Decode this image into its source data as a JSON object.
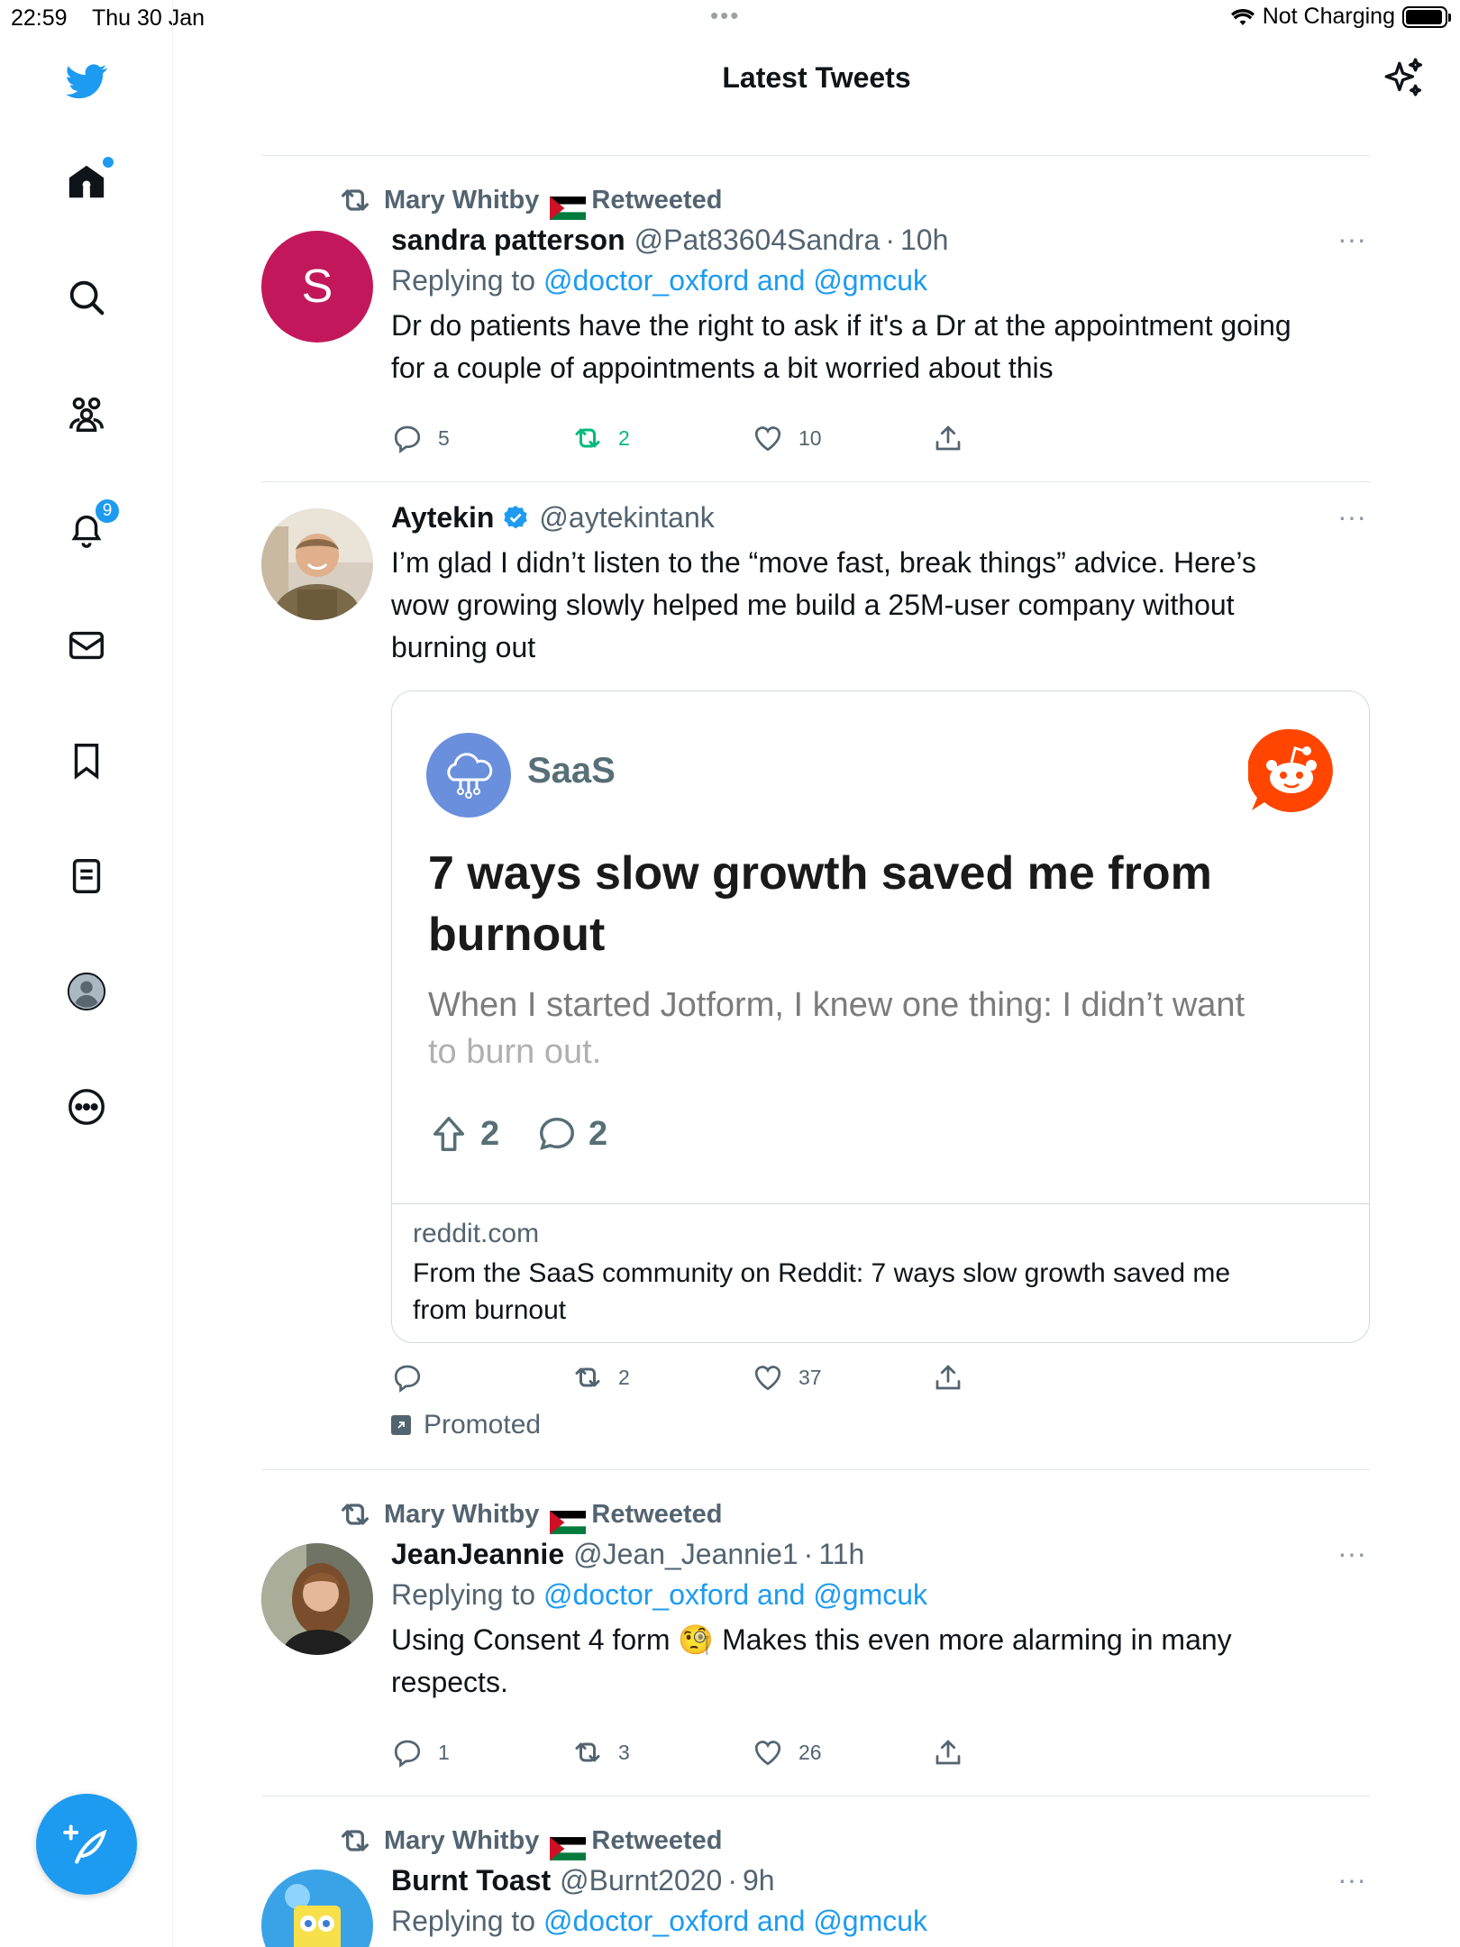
{
  "status_bar": {
    "time": "22:59",
    "date": "Thu 30 Jan",
    "dots": "•••",
    "charging": "Not Charging",
    "battery_level_fraction": 0.95
  },
  "header": {
    "title": "Latest Tweets",
    "sparkle_icon": "sparkle-icon"
  },
  "sidebar": {
    "items": [
      {
        "icon": "twitter-logo-icon"
      },
      {
        "icon": "home-icon"
      },
      {
        "icon": "search-icon"
      },
      {
        "icon": "communities-icon"
      },
      {
        "icon": "notifications-icon",
        "badge": "9"
      },
      {
        "icon": "messages-icon"
      },
      {
        "icon": "bookmarks-icon"
      },
      {
        "icon": "lists-icon"
      },
      {
        "icon": "profile-icon"
      },
      {
        "icon": "more-icon"
      }
    ],
    "compose_icon": "compose-tweet-icon"
  },
  "tweets": [
    {
      "retweeted_by": "Mary Whitby",
      "retweeted_label": "Retweeted",
      "avatar_letter": "S",
      "name": "sandra patterson",
      "handle": "@Pat83604Sandra",
      "time": "10h",
      "replying_prefix": "Replying to",
      "replying_to": "@doctor_oxford and @gmcuk",
      "text_lines": [
        "Dr do patients have the right to ask if it's a Dr  at the appointment going",
        "for a couple of appointments a bit worried about this"
      ],
      "replies": "5",
      "retweets": "2",
      "likes": "10"
    },
    {
      "name": "Aytekin",
      "handle": "@aytekintank",
      "text_lines": [
        "I’m glad I didn’t listen to the “move fast, break things” advice. Here’s",
        "wow growing slowly helped me build a 25M-user company without",
        "burning out"
      ],
      "card": {
        "community": "SaaS",
        "headline_lines": [
          "7 ways slow growth saved me from",
          "burnout"
        ],
        "excerpt_lines": [
          "When I started Jotform, I knew one thing: I didn’t want",
          "to burn out."
        ],
        "upvotes": "2",
        "comments": "2",
        "domain": "reddit.com",
        "title_lines": [
          "From the SaaS community on Reddit: 7 ways slow growth saved me",
          "from burnout"
        ]
      },
      "replies": "",
      "retweets": "2",
      "likes": "37",
      "promoted": "Promoted"
    },
    {
      "retweeted_by": "Mary Whitby",
      "retweeted_label": "Retweeted",
      "name": "JeanJeannie",
      "handle": "@Jean_Jeannie1",
      "time": "11h",
      "replying_prefix": "Replying to",
      "replying_to": "@doctor_oxford and @gmcuk",
      "text_lines": [
        "Using Consent 4 form 🧐 Makes this even more alarming in many",
        "respects."
      ],
      "replies": "1",
      "retweets": "3",
      "likes": "26"
    },
    {
      "retweeted_by": "Mary Whitby",
      "retweeted_label": "Retweeted",
      "name": "Burnt Toast",
      "handle": "@Burnt2020",
      "time": "9h",
      "replying_prefix": "Replying to",
      "replying_to": "@doctor_oxford and @gmcuk"
    }
  ],
  "colors": {
    "accent": "#1d9bf0",
    "retweet_green": "#00ba7c",
    "secondary_text": "#536471",
    "reddit_orange": "#ff4500",
    "avatar_s": "#c2185b"
  }
}
